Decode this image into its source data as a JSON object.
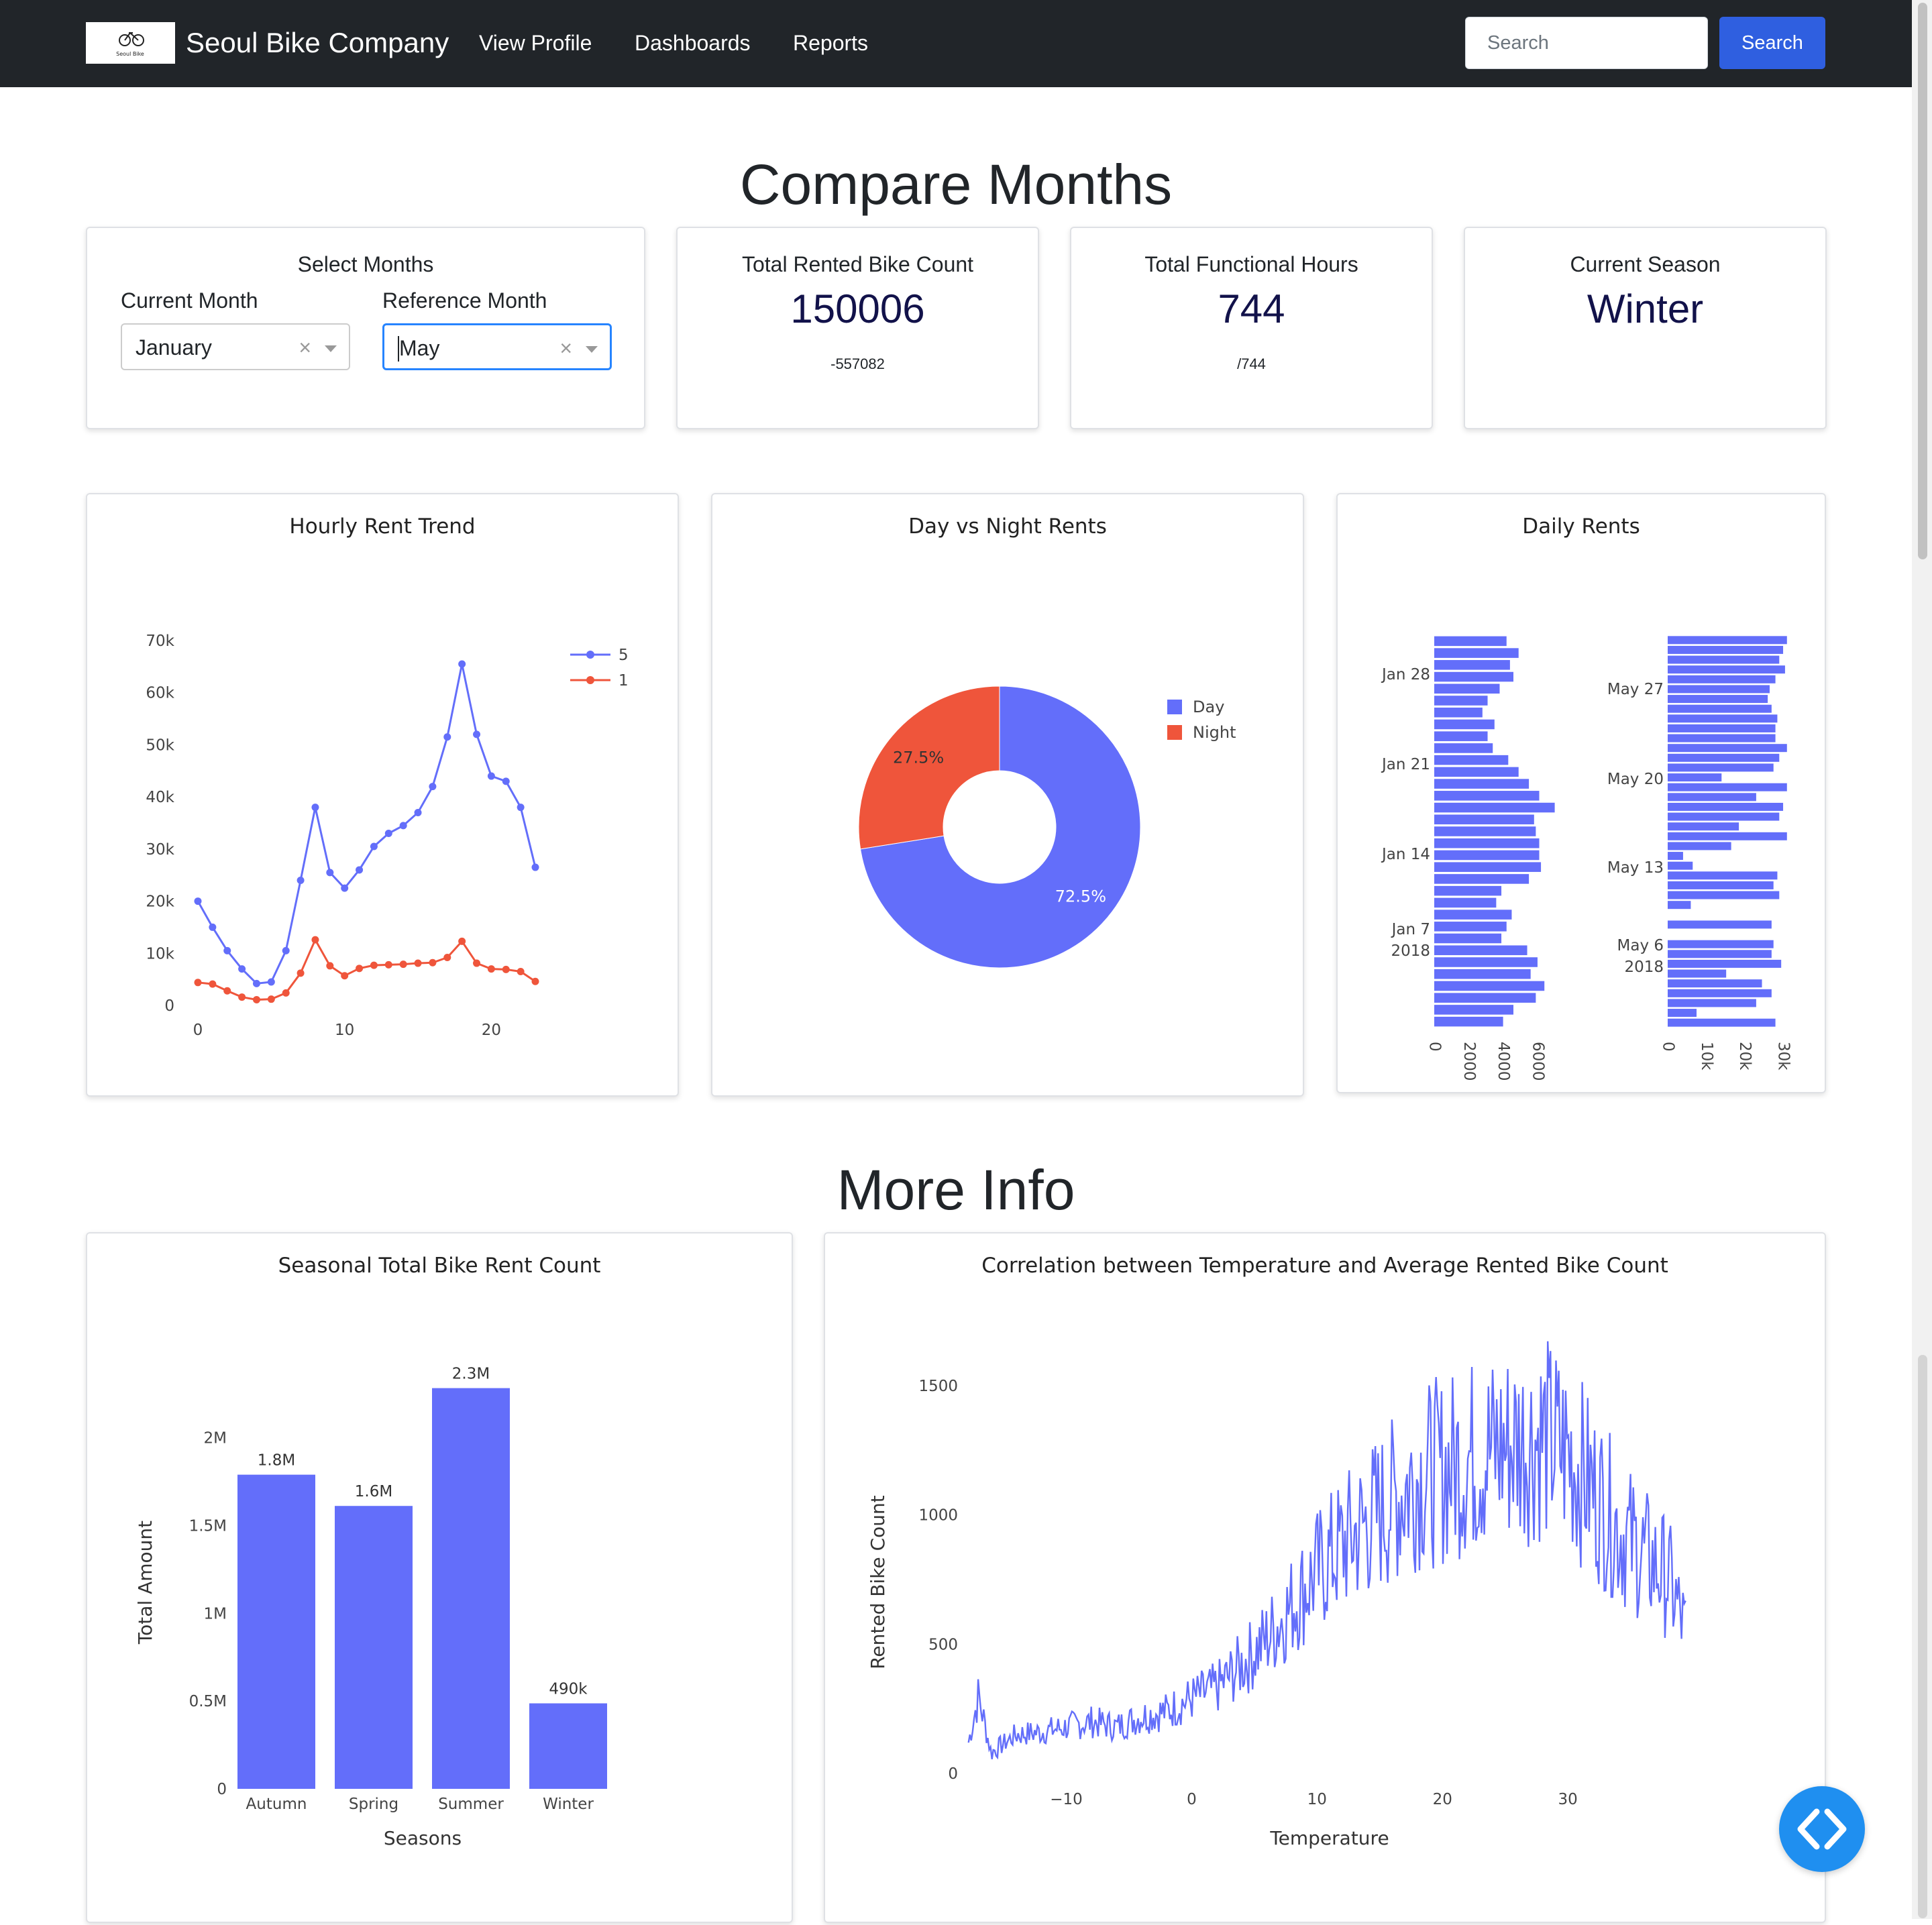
{
  "navbar": {
    "brand": "Seoul Bike Company",
    "logo_text": "Seoul Bike",
    "links": [
      "View Profile",
      "Dashboards",
      "Reports"
    ],
    "search_placeholder": "Search",
    "search_button": "Search"
  },
  "compare_title": "Compare Months",
  "select_months": {
    "title": "Select Months",
    "current_label": "Current Month",
    "reference_label": "Reference Month",
    "current_value": "January",
    "reference_value": "May"
  },
  "kpis": [
    {
      "title": "Total Rented Bike Count",
      "value": "150006",
      "sub": "-557082"
    },
    {
      "title": "Total Functional Hours",
      "value": "744",
      "sub": "/744"
    },
    {
      "title": "Current Season",
      "value": "Winter",
      "sub": ""
    }
  ],
  "more_info_title": "More Info",
  "icons": {
    "clear": "×",
    "code": "code-brackets-icon",
    "dropdown": "chevron-down-icon"
  },
  "colors": {
    "blue": "#636efa",
    "red": "#ef553b",
    "navy": "#12124a",
    "accent": "#2f5fe0"
  },
  "chart_data": [
    {
      "type": "line",
      "title": "Hourly Rent Trend",
      "x": [
        0,
        1,
        2,
        3,
        4,
        5,
        6,
        7,
        8,
        9,
        10,
        11,
        12,
        13,
        14,
        15,
        16,
        17,
        18,
        19,
        20,
        21,
        22,
        23
      ],
      "series": [
        {
          "name": "5",
          "values": [
            20000,
            15000,
            10500,
            7000,
            4200,
            4500,
            10500,
            24000,
            38000,
            25500,
            22500,
            26000,
            30500,
            33000,
            34500,
            37000,
            42000,
            51500,
            65500,
            52000,
            44000,
            43000,
            38000,
            26500
          ]
        },
        {
          "name": "1",
          "values": [
            4400,
            4100,
            2800,
            1600,
            1100,
            1200,
            2400,
            6200,
            12600,
            7600,
            5700,
            7100,
            7700,
            7800,
            7900,
            8100,
            8200,
            9200,
            12300,
            8100,
            7000,
            6900,
            6500,
            4600
          ]
        }
      ],
      "xticks": [
        "0",
        "10",
        "20"
      ],
      "yticks": [
        "0",
        "10k",
        "20k",
        "30k",
        "40k",
        "50k",
        "60k",
        "70k"
      ],
      "ylim": [
        0,
        70000
      ],
      "xlim": [
        0,
        23
      ],
      "legend": "top-right"
    },
    {
      "type": "pie",
      "title": "Day vs Night Rents",
      "labels": [
        "Day",
        "Night"
      ],
      "values": [
        72.5,
        27.5
      ],
      "value_labels": [
        "72.5%",
        "27.5%"
      ],
      "hole": 0.4,
      "legend": "right"
    },
    {
      "type": "bar",
      "title": "Daily Rents",
      "orientation": "horizontal",
      "subplots": [
        {
          "month": "January",
          "ytick_labels": [
            "Jan 28",
            "Jan 21",
            "Jan 14",
            "Jan 7",
            "2018"
          ],
          "xticks": [
            "0",
            "2000",
            "4000",
            "6000"
          ],
          "xlim": [
            0,
            7600
          ],
          "values": [
            4200,
            4900,
            4400,
            4600,
            3800,
            3100,
            2800,
            3500,
            3100,
            3400,
            4300,
            4900,
            5500,
            6100,
            7000,
            5800,
            5900,
            6100,
            6100,
            6200,
            5500,
            3900,
            3600,
            4500,
            4200,
            3900,
            5400,
            6000,
            5600,
            6400,
            5900,
            4600,
            4000
          ]
        },
        {
          "month": "May",
          "ytick_labels": [
            "May 27",
            "May 20",
            "May 13",
            "May 6",
            "2018"
          ],
          "xticks": [
            "0",
            "10k",
            "20k",
            "30k"
          ],
          "xlim": [
            0,
            34000
          ],
          "values": [
            31000,
            30000,
            29000,
            30500,
            28000,
            26500,
            26000,
            27000,
            28500,
            28000,
            28000,
            31000,
            29000,
            27500,
            14000,
            31000,
            23000,
            30000,
            29000,
            18500,
            31000,
            16500,
            4000,
            6500,
            28500,
            27500,
            29000,
            6000,
            0,
            27000,
            0,
            27500,
            27000,
            29500,
            15200,
            24500,
            27000,
            23000,
            7500,
            28000
          ]
        }
      ]
    },
    {
      "type": "bar",
      "title": "Seasonal Total Bike Rent Count",
      "categories": [
        "Autumn",
        "Spring",
        "Summer",
        "Winter"
      ],
      "values": [
        1790002,
        1611909,
        2283234,
        487169
      ],
      "value_labels": [
        "1.8M",
        "1.6M",
        "2.3M",
        "490k"
      ],
      "xlabel": "Seasons",
      "ylabel": "Total Amount",
      "yticks": [
        "0",
        "0.5M",
        "1M",
        "1.5M",
        "2M"
      ],
      "ylim": [
        0,
        2400000
      ]
    },
    {
      "type": "line",
      "title": "Correlation between Temperature and Average Rented Bike Count",
      "xlabel": "Temperature",
      "ylabel": "Rented Bike Count",
      "xticks": [
        "−10",
        "0",
        "10",
        "20",
        "30"
      ],
      "yticks": [
        "0",
        "500",
        "1000",
        "1500"
      ],
      "xlim": [
        -18,
        40
      ],
      "ylim": [
        0,
        1700
      ],
      "trend": [
        [
          -17.8,
          120
        ],
        [
          -17,
          300
        ],
        [
          -16,
          80
        ],
        [
          -14,
          150
        ],
        [
          -12,
          160
        ],
        [
          -10,
          180
        ],
        [
          -8,
          200
        ],
        [
          -6,
          180
        ],
        [
          -4,
          220
        ],
        [
          -2,
          240
        ],
        [
          0,
          290
        ],
        [
          2,
          330
        ],
        [
          4,
          420
        ],
        [
          6,
          520
        ],
        [
          8,
          650
        ],
        [
          10,
          780
        ],
        [
          12,
          880
        ],
        [
          14,
          970
        ],
        [
          16,
          1050
        ],
        [
          18,
          1150
        ],
        [
          20,
          1170
        ],
        [
          22,
          1220
        ],
        [
          24,
          1250
        ],
        [
          26,
          1280
        ],
        [
          28,
          1300
        ],
        [
          30,
          1240
        ],
        [
          32,
          1100
        ],
        [
          34,
          950
        ],
        [
          36,
          850
        ],
        [
          37,
          800
        ],
        [
          38,
          760
        ],
        [
          39.4,
          550
        ]
      ]
    }
  ]
}
